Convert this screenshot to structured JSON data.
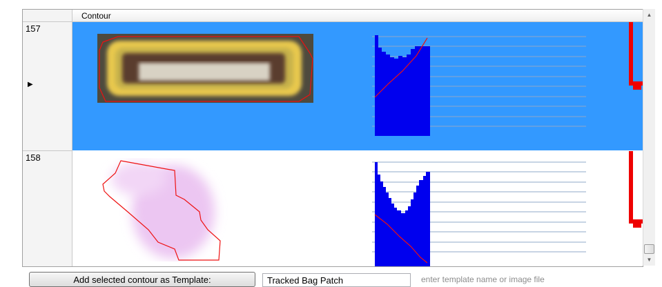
{
  "grid": {
    "column_header": "Contour",
    "rows": [
      {
        "number": "157",
        "selected": true,
        "pointer": "▶"
      },
      {
        "number": "158",
        "selected": false,
        "pointer": ""
      }
    ]
  },
  "footer": {
    "add_button_label": "Add selected contour as Template:",
    "template_name_value": "Tracked Bag Patch",
    "hint_text": "enter template name or image file"
  },
  "colors": {
    "selection": "#3399ff",
    "histogram": "#0000ee",
    "contour_outline": "#ee1111"
  },
  "icons": {
    "scroll_up": "triangle-up-icon",
    "scroll_down": "triangle-down-icon",
    "row_pointer": "triangle-right-icon"
  }
}
